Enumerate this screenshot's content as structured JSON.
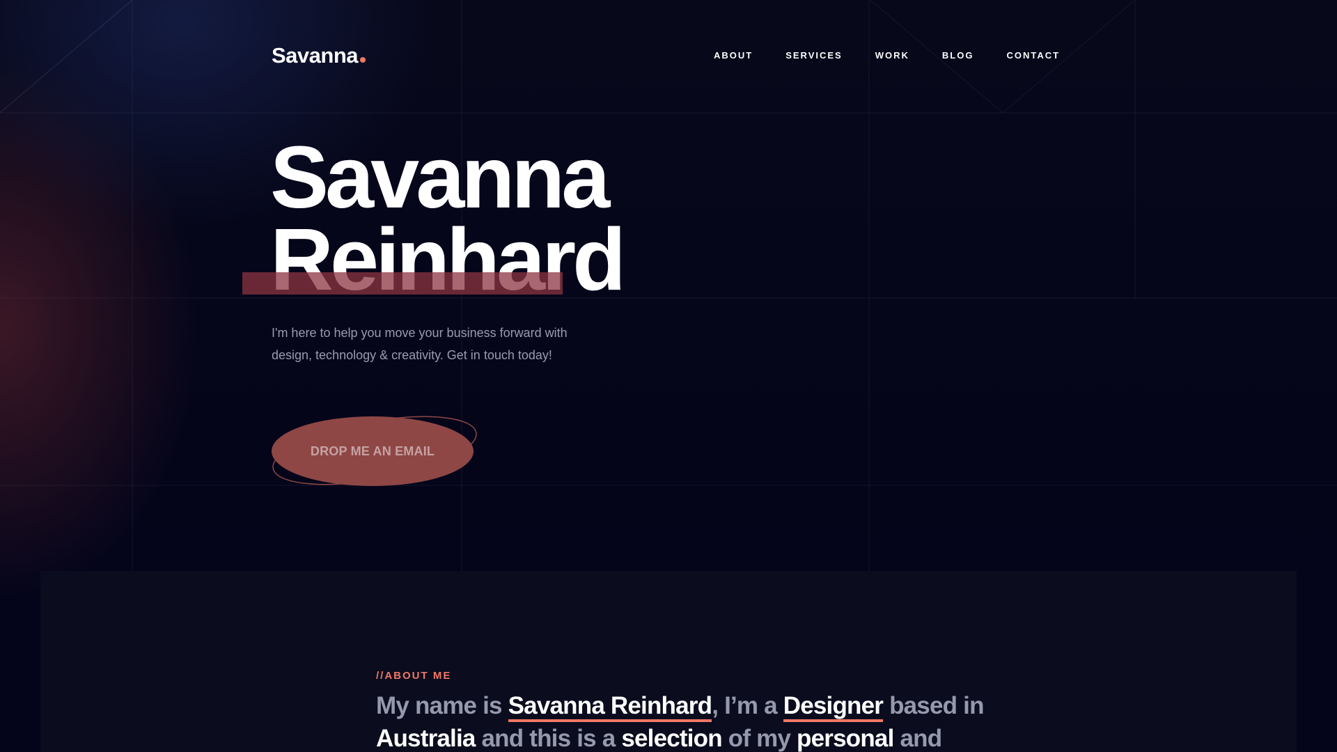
{
  "brand": {
    "name": "Savanna",
    "dot_color": "#f07866"
  },
  "nav": {
    "items": [
      "ABOUT",
      "SERVICES",
      "WORK",
      "BLOG",
      "CONTACT"
    ]
  },
  "hero": {
    "first_name": "Savanna",
    "last_name": "Reinhard",
    "subtitle": "I'm here to help you move your business forward with design, technology & creativity. Get in touch today!",
    "cta_label": "DROP ME AN EMAIL"
  },
  "about": {
    "label": "//ABOUT ME",
    "text": {
      "p1": "My name is ",
      "name": "Savanna Reinhard",
      "p2": ", I’m a ",
      "role": "Designer",
      "p3": " based in ",
      "location": "Australia",
      "p4": " and this is a ",
      "w1": "selection",
      "p5": " of my ",
      "w2": "personal",
      "p6": " and"
    }
  },
  "colors": {
    "accent": "#f07866",
    "background": "#050615",
    "cta": "#8e4745"
  }
}
